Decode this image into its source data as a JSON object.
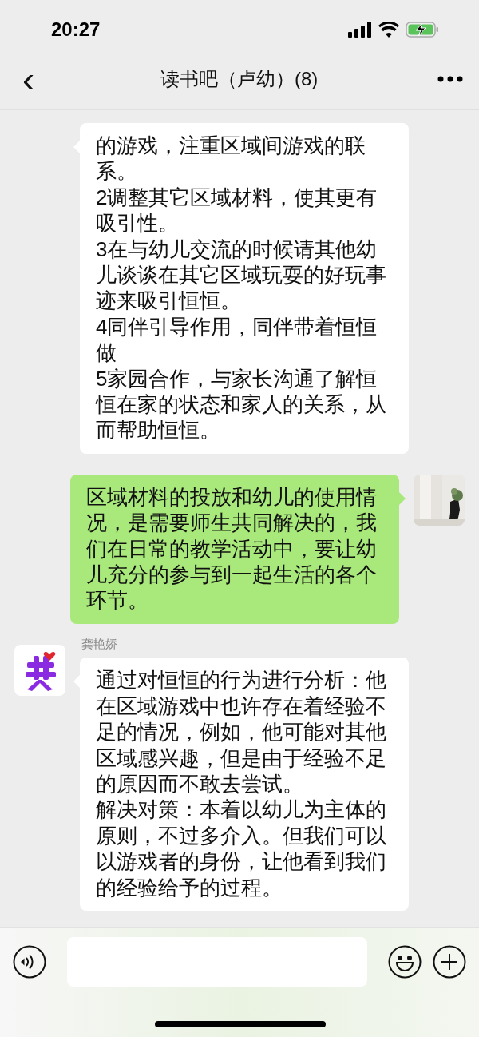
{
  "status_bar": {
    "time": "20:27",
    "battery_charging": true
  },
  "header": {
    "back": "‹",
    "title": "读书吧（卢幼）(8)"
  },
  "messages": [
    {
      "kind": "received",
      "paragraphs": [
        "的游戏，注重区域间游戏的联系。",
        "2调整其它区域材料，使其更有吸引性。",
        "3在与幼儿交流的时候请其他幼儿谈谈在其它区域玩耍的好玩事迹来吸引恒恒。",
        "4同伴引导作用，同伴带着恒恒做",
        "5家园合作，与家长沟通了解恒恒在家的状态和家人的关系，从而帮助恒恒。"
      ]
    },
    {
      "kind": "sent",
      "paragraphs": [
        "区域材料的投放和幼儿的使用情况，是需要师生共同解决的，我们在日常的教学活动中，要让幼儿充分的参与到一起生活的各个环节。"
      ],
      "avatar": {
        "kind": "picture"
      }
    },
    {
      "kind": "received",
      "sender": "龚艳娇",
      "paragraphs": [
        "通过对恒恒的行为进行分析：他在区域游戏中也许存在着经验不足的情况，例如，他可能对其他区域感兴趣，但是由于经验不足的原因而不敢去尝试。",
        "解决对策：本着以幼儿为主体的原则，不过多介入。但我们可以以游戏者的身份，让他看到我们的经验给予的过程。"
      ],
      "avatar": {
        "kind": "picture"
      }
    }
  ]
}
